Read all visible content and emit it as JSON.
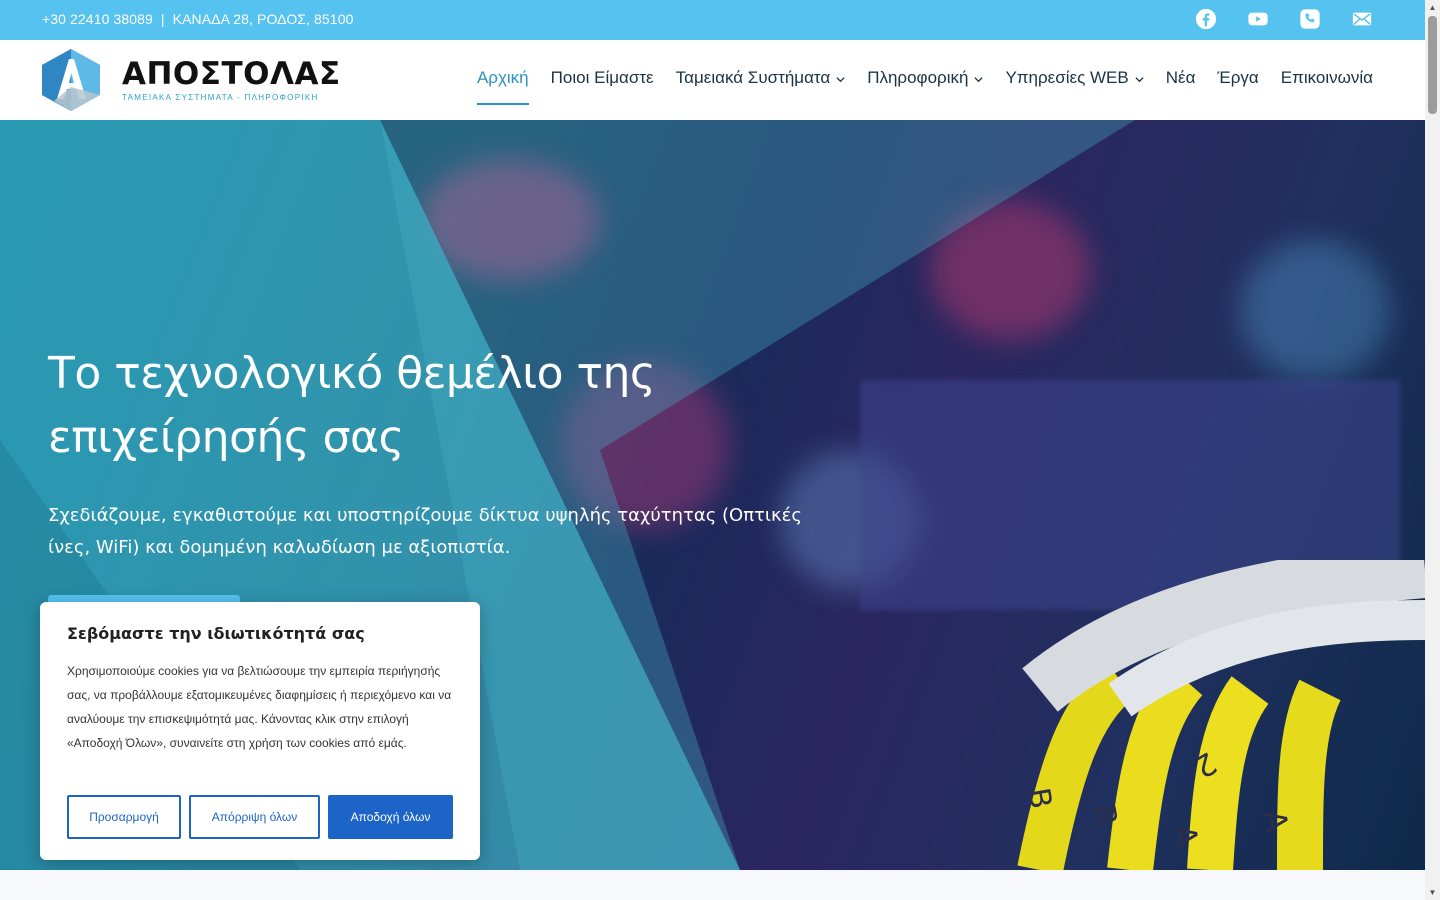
{
  "topbar": {
    "phone": "+30 22410 38089",
    "separator": "|",
    "address": "ΚΑΝΑΔΑ 28, ΡΟΔΟΣ, 85100",
    "icons": [
      "facebook-icon",
      "youtube-icon",
      "phone-icon",
      "mail-icon"
    ],
    "bg_color": "#55c2ef"
  },
  "logo": {
    "name": "ΑΠΟΣΤΟΛΑΣ",
    "tagline": "ΤΑΜΕΙΑΚΑ ΣΥΣΤΗΜΑΤΑ - ΠΛΗΡΟΦΟΡΙΚΗ"
  },
  "nav": {
    "items": [
      {
        "label": "Αρχική",
        "active": true,
        "dropdown": false
      },
      {
        "label": "Ποιοι Είμαστε",
        "active": false,
        "dropdown": false
      },
      {
        "label": "Ταμειακά Συστήματα",
        "active": false,
        "dropdown": true
      },
      {
        "label": "Πληροφορική",
        "active": false,
        "dropdown": true
      },
      {
        "label": "Υπηρεσίες WEB",
        "active": false,
        "dropdown": true
      },
      {
        "label": "Νέα",
        "active": false,
        "dropdown": false
      },
      {
        "label": "Έργα",
        "active": false,
        "dropdown": false
      },
      {
        "label": "Επικοινωνία",
        "active": false,
        "dropdown": false
      }
    ],
    "active_color": "#2d93c1"
  },
  "hero": {
    "title_line1": "Το τεχνολογικό θεμέλιο της",
    "title_line2": "επιχείρησής σας",
    "subtitle_line1": "Σχεδιάζουμε, εγκαθιστούμε και υποστηρίζουμε δίκτυα υψηλής ταχύτητας (Οπτικές",
    "subtitle_line2": "ίνες, WiFi) και δομημένη καλωδίωση με αξιοπιστία.",
    "cable_labels": [
      "1",
      "B",
      "B",
      "2",
      "A",
      "1",
      "A"
    ]
  },
  "cookie": {
    "title": "Σεβόμαστε την ιδιωτικότητά σας",
    "text": "Χρησιμοποιούμε cookies για να βελτιώσουμε την εμπειρία περιήγησής σας, να προβάλλουμε εξατομικευμένες διαφημίσεις ή περιεχόμενο και να αναλύουμε την επισκεψιμότητά μας. Κάνοντας κλικ στην επιλογή «Αποδοχή Όλων», συναινείτε στη χρήση των cookies από εμάς.",
    "customize": "Προσαρμογή",
    "reject": "Απόρριψη όλων",
    "accept": "Αποδοχή όλων",
    "accent_color": "#1c64c8"
  }
}
